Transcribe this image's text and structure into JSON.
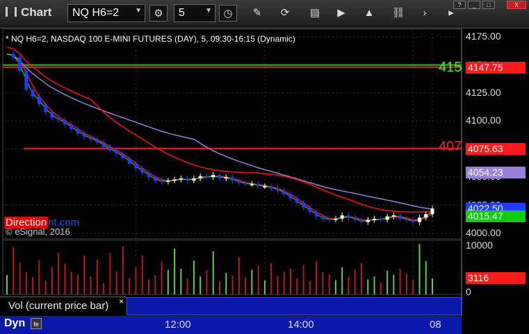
{
  "app": {
    "title": "Chart"
  },
  "toolbar": {
    "symbol_value": "NQ H6=2",
    "interval_value": "5",
    "icons": [
      "settings-gear-icon",
      "clock-icon",
      "pencil-icon",
      "cursor-link-icon",
      "news-icon",
      "play-icon",
      "arrow-up-icon",
      "link-icon",
      "chevron-right-icon",
      "more-icon"
    ]
  },
  "window": {
    "help_label": "?",
    "minimize_label": "_",
    "maximize_label": "□",
    "close_label": "X"
  },
  "chart": {
    "title": "* NQ H6=2, NASDAQ 100 E-MINI FUTURES (DAY), 5, 09:30-16:15 (Dynamic)",
    "copyright": "© eSignal, 2016",
    "watermark_left": "Direction",
    "watermark_right": "nt.com",
    "level_label_upper": "415",
    "level_label_lower": "407",
    "colors": {
      "candle_up": "#ffffff",
      "candle_down": "#1f3cff",
      "red_line": "#ff1010",
      "ma_purple": "#9a80d8",
      "ma_green": "#10ff10",
      "upper_level": "#22cc22"
    }
  },
  "chart_data": [
    {
      "type": "candlestick",
      "title": "* NQ H6=2, NASDAQ 100 E-MINI FUTURES (DAY), 5, 09:30-16:15 (Dynamic)",
      "y_ticks": [
        "4175.00",
        "4150.00",
        "4125.00",
        "4100.00",
        "4075.00",
        "4050.00",
        "4025.00",
        "4000.00"
      ],
      "ylim": [
        3995,
        4182
      ],
      "x_ticks": [
        "12:00",
        "14:00",
        "08"
      ],
      "price_tags": [
        {
          "label": "4147.75",
          "color": "#ff1a1a"
        },
        {
          "label": "4075.63",
          "color": "#ff1a1a"
        },
        {
          "label": "4054.23",
          "color": "#9a80d8"
        },
        {
          "label": "4022.50",
          "color": "#1f3cff"
        },
        {
          "label": "4015.47",
          "color": "#10cc10"
        }
      ],
      "horizontal_levels": [
        {
          "label": "415",
          "value": 4150,
          "color": "#22cc22"
        },
        {
          "label": "",
          "value": 4148,
          "color": "#ff1a1a"
        },
        {
          "label": "407",
          "value": 4075.63,
          "color": "#ff1a1a"
        }
      ],
      "close": [
        4160,
        4157,
        4145,
        4128,
        4122,
        4115,
        4108,
        4103,
        4101,
        4097,
        4093,
        4089,
        4086,
        4084,
        4081,
        4077,
        4074,
        4071,
        4067,
        4062,
        4058,
        4054,
        4050,
        4047,
        4046,
        4047,
        4048,
        4049,
        4047,
        4049,
        4051,
        4050,
        4052,
        4049,
        4050,
        4047,
        4045,
        4044,
        4044,
        4042,
        4042,
        4040,
        4038,
        4035,
        4031,
        4027,
        4023,
        4019,
        4015,
        4013,
        4012,
        4013,
        4016,
        4014,
        4012,
        4010,
        4012,
        4013,
        4012,
        4015,
        4016,
        4013,
        4012,
        4010,
        4014,
        4017,
        4022
      ]
    },
    {
      "type": "bar",
      "title": "Vol (current price bar)",
      "y_ticks": [
        "10000",
        "0"
      ],
      "ylim": [
        0,
        10000
      ],
      "last_value_label": "3116",
      "values": [
        3800,
        9200,
        6200,
        4300,
        3400,
        6700,
        2700,
        5300,
        8100,
        6000,
        4400,
        3900,
        7500,
        3500,
        6800,
        2200,
        8100,
        4500,
        9400,
        3200,
        5400,
        7600,
        2900,
        3700,
        6400,
        4800,
        8900,
        5000,
        3100,
        6600,
        3500,
        4700,
        8400,
        2500,
        4200,
        3700,
        7200,
        3300,
        4800,
        5600,
        2700,
        6100,
        3600,
        4400,
        5000,
        3100,
        5800,
        2600,
        6500,
        4300,
        3900,
        2800,
        5300,
        3400,
        4900,
        6100,
        2900,
        3500,
        2300,
        4600,
        3800,
        5000,
        4000,
        2800,
        9800,
        6500,
        3116
      ]
    }
  ]
}
